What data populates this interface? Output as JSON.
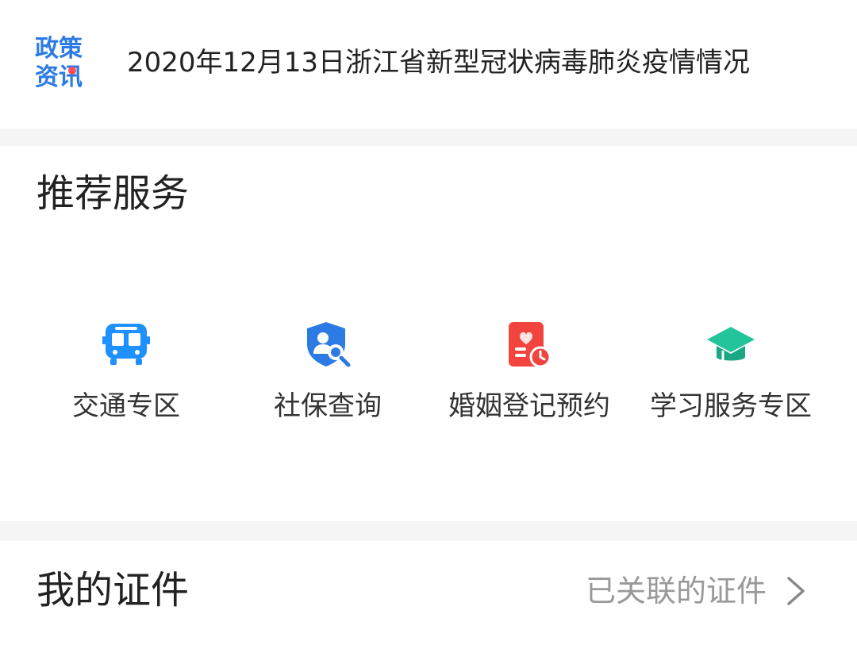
{
  "news": {
    "logo_line1": "政策",
    "logo_line2": "资讯",
    "headline": "2020年12月13日浙江省新型冠状病毒肺炎疫情情况"
  },
  "services": {
    "title": "推荐服务",
    "items": [
      {
        "label": "交通专区",
        "icon": "bus-icon",
        "color": "#1e90ff"
      },
      {
        "label": "社保查询",
        "icon": "shield-search-icon",
        "color": "#2c7be5"
      },
      {
        "label": "婚姻登记预约",
        "icon": "heart-calendar-icon",
        "color": "#f2443f"
      },
      {
        "label": "学习服务专区",
        "icon": "graduation-cap-icon",
        "color": "#23c49b"
      }
    ]
  },
  "certificates": {
    "title": "我的证件",
    "link_label": "已关联的证件"
  }
}
